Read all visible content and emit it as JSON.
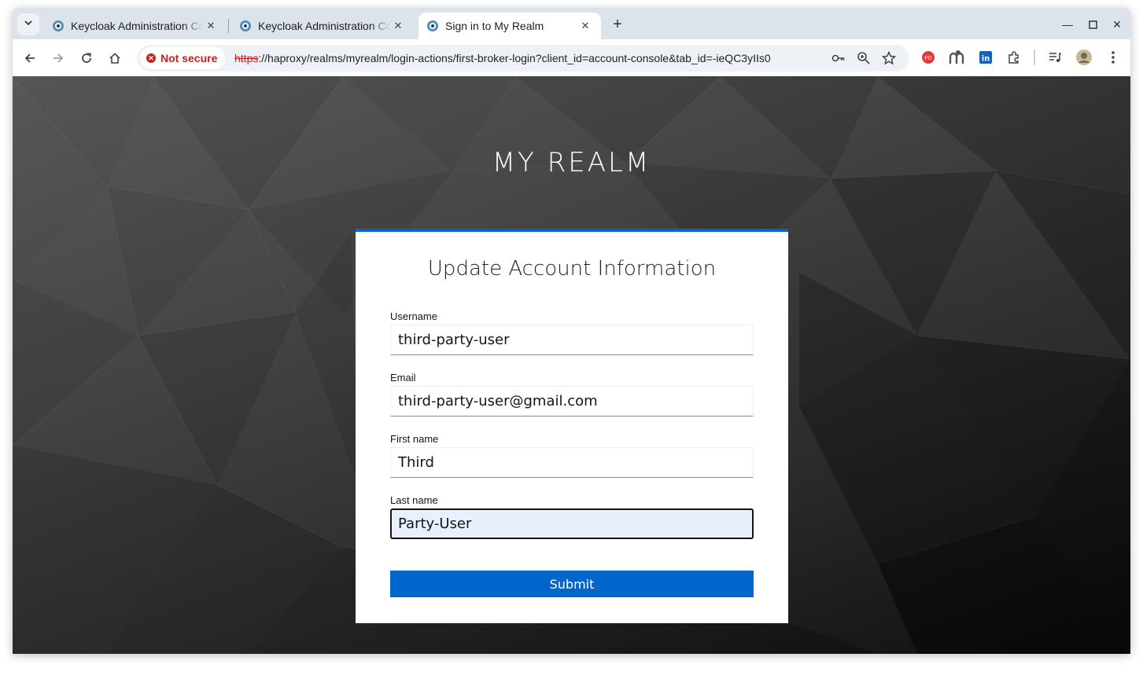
{
  "browser": {
    "tabs": [
      {
        "title": "Keycloak Administration Console",
        "active": false
      },
      {
        "title": "Keycloak Administration Console",
        "active": false
      },
      {
        "title": "Sign in to My Realm",
        "active": true
      }
    ],
    "security_label": "Not secure",
    "url_scheme": "https",
    "url_rest": "://haproxy/realms/myrealm/login-actions/first-broker-login?client_id=account-console&tab_id=-ieQC3yIIs0"
  },
  "page": {
    "realm_title": "MY REALM",
    "form_title": "Update Account Information",
    "fields": [
      {
        "label": "Username",
        "value": "third-party-user"
      },
      {
        "label": "Email",
        "value": "third-party-user@gmail.com"
      },
      {
        "label": "First name",
        "value": "Third"
      },
      {
        "label": "Last name",
        "value": "Party-User"
      }
    ],
    "submit_label": "Submit"
  },
  "colors": {
    "accent": "#0066cc",
    "insecure": "#c5221f"
  }
}
